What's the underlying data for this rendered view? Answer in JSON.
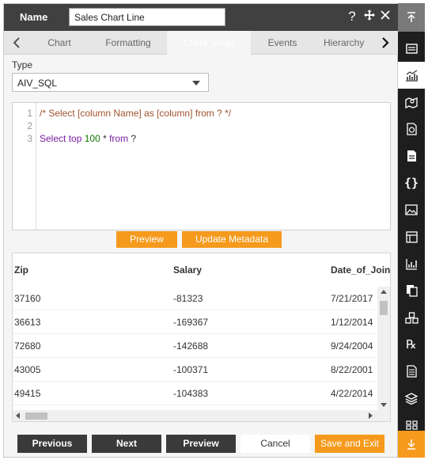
{
  "header": {
    "name_label": "Name",
    "name_value": "Sales Chart Line",
    "help_icon": "help-icon",
    "move_icon": "move-icon",
    "close_icon": "close-icon"
  },
  "tabs": {
    "items": [
      {
        "label": "Chart"
      },
      {
        "label": "Formatting"
      },
      {
        "label": "Client Script"
      },
      {
        "label": "Events"
      },
      {
        "label": "Hierarchy"
      }
    ],
    "active_index": 2
  },
  "type": {
    "label": "Type",
    "value": "AIV_SQL"
  },
  "editor": {
    "line_numbers": [
      "1",
      "2",
      "3"
    ],
    "line1": "/* Select [column Name] as [column] from ? */",
    "line3": {
      "kw1": "Select",
      "top": " top ",
      "num": "100",
      "star": " * ",
      "kw2": "from",
      "q": " ?"
    }
  },
  "actions": {
    "preview_label": "Preview",
    "update_metadata_label": "Update Metadata"
  },
  "grid": {
    "columns": [
      "Zip",
      "Salary",
      "Date_of_Join"
    ],
    "rows": [
      [
        "37160",
        "-81323",
        "7/21/2017"
      ],
      [
        "36613",
        "-169367",
        "1/12/2014"
      ],
      [
        "72680",
        "-142688",
        "9/24/2004"
      ],
      [
        "43005",
        "-100371",
        "8/22/2001"
      ],
      [
        "49415",
        "-104383",
        "4/22/2014"
      ]
    ]
  },
  "footer": {
    "previous_label": "Previous",
    "next_label": "Next",
    "preview_label": "Preview",
    "cancel_label": "Cancel",
    "save_exit_label": "Save and Exit"
  },
  "colors": {
    "accent": "#f59a1c",
    "header_bg": "#404040",
    "sidebar_bg": "#1e1e1e",
    "dark_button": "#3a3a3a"
  },
  "sidebar": {
    "top_icon": "collapse-up-icon",
    "items": [
      "list-icon",
      "chart-icon",
      "map-icon",
      "report-icon",
      "document-icon",
      "braces-icon",
      "image-icon",
      "widget-icon",
      "analytics-icon",
      "copy-icon",
      "cubes-icon",
      "rx-icon",
      "template-icon",
      "layers-icon",
      "grid-icon"
    ],
    "bottom_icon": "download-icon"
  }
}
